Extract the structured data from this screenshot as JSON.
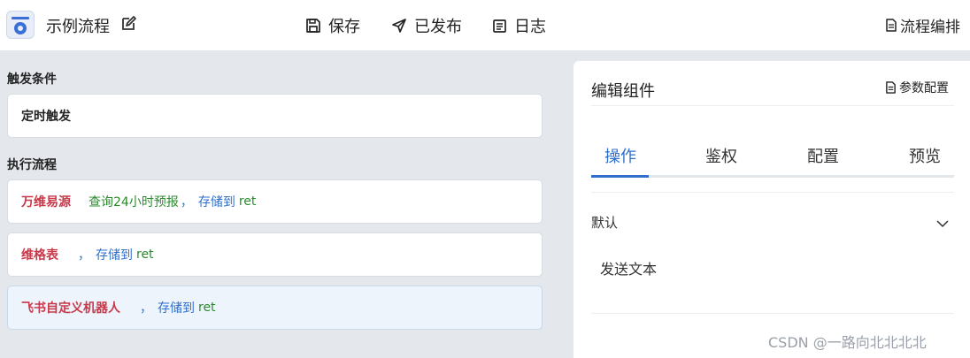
{
  "header": {
    "title": "示例流程",
    "save_label": "保存",
    "published_label": "已发布",
    "log_label": "日志",
    "flow_label": "流程编排"
  },
  "left": {
    "trigger_section": "触发条件",
    "trigger_card": "定时触发",
    "flow_section": "执行流程",
    "steps": [
      {
        "name": "万维易源",
        "desc": "查询24小时预报",
        "sep": "，",
        "store": "存储到",
        "var": "ret"
      },
      {
        "name": "维格表",
        "desc": "",
        "sep": "，",
        "store": "存储到",
        "var": "ret"
      },
      {
        "name": "飞书自定义机器人",
        "desc": "",
        "sep": "，",
        "store": "存储到",
        "var": "ret"
      }
    ]
  },
  "right": {
    "title": "编辑组件",
    "param_label": "参数配置",
    "tabs": [
      "操作",
      "鉴权",
      "配置",
      "预览"
    ],
    "active_tab": "操作",
    "collapse_label": "默认",
    "collapse_item": "发送文本"
  },
  "watermark": "CSDN @一路向北北北北",
  "colors": {
    "accent": "#2f6fcc",
    "step_name": "#c8394a",
    "step_desc": "#2b8a2e",
    "pane_bg": "#e4e7ec"
  },
  "icons": [
    "app-logo-icon",
    "edit-icon",
    "save-icon",
    "send-icon",
    "log-icon",
    "document-icon",
    "chevron-down-icon"
  ]
}
